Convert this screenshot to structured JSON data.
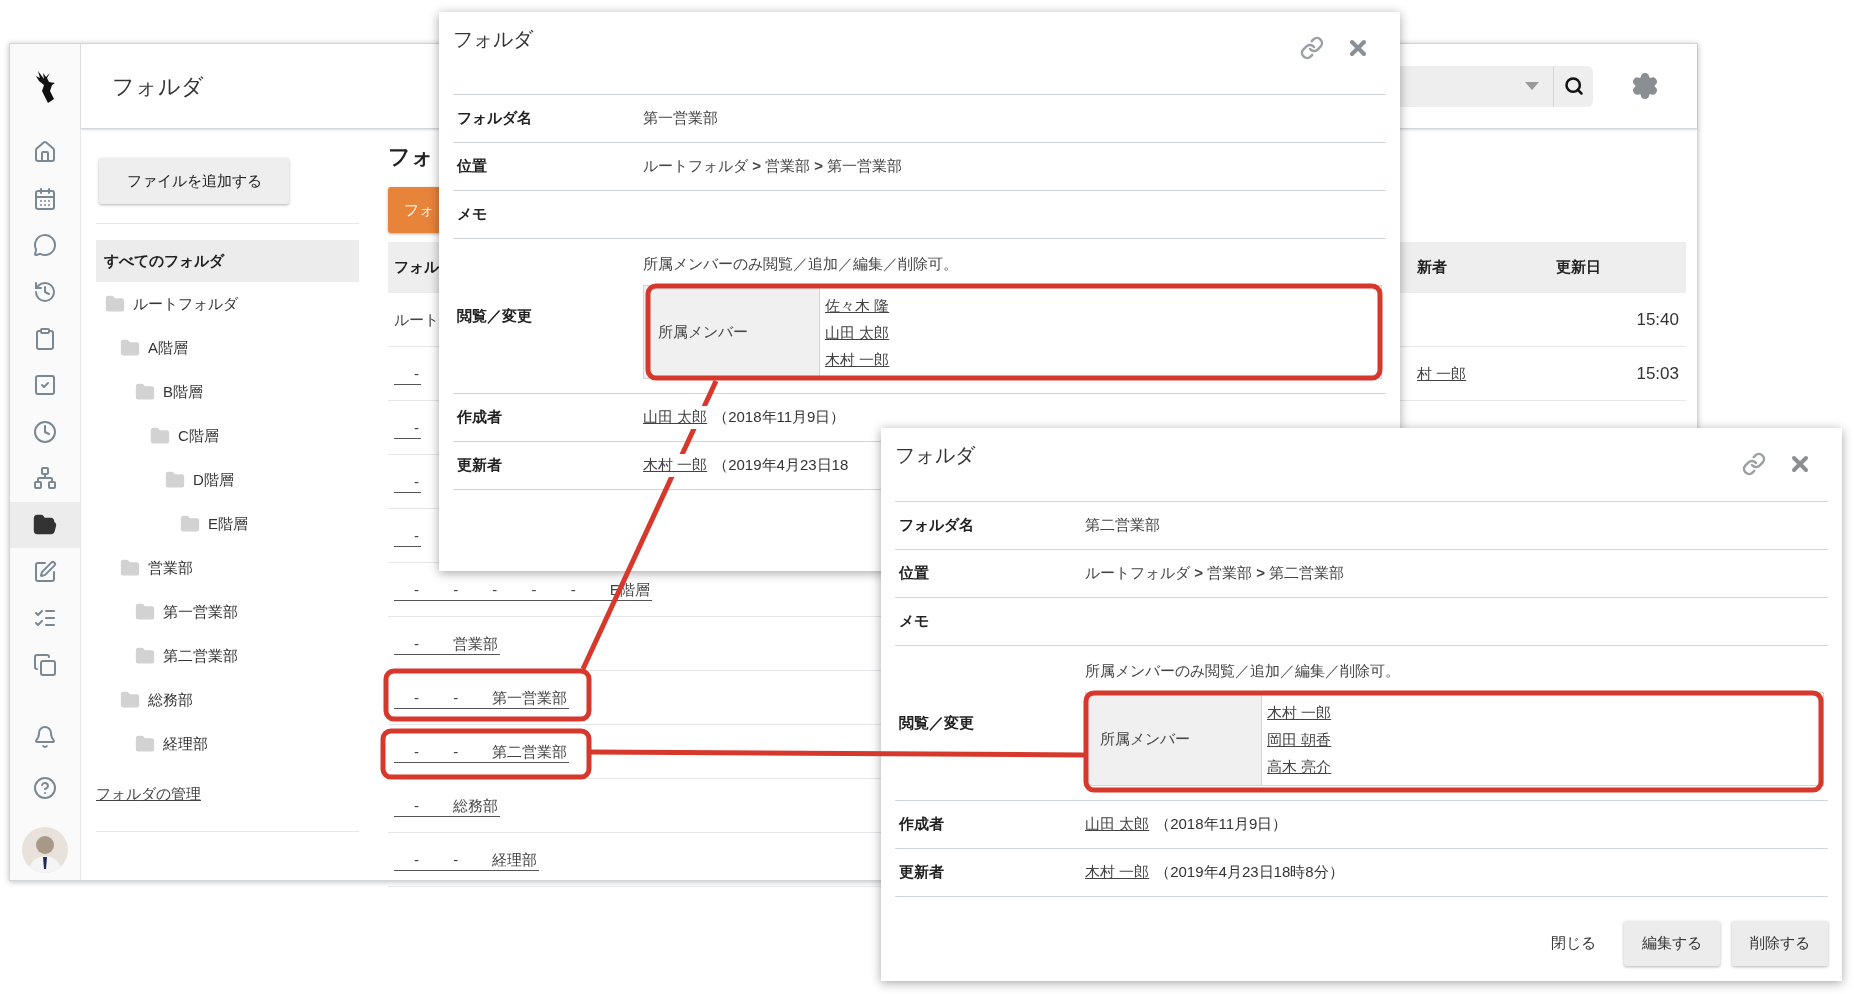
{
  "app": {
    "title": "フォルダ",
    "nav": [
      {
        "selected": false
      },
      {
        "selected": false
      },
      {
        "selected": false
      },
      {
        "selected": false
      },
      {
        "selected": false
      },
      {
        "selected": false
      },
      {
        "selected": false
      },
      {
        "selected": false
      },
      {
        "selected": true
      },
      {
        "selected": false
      },
      {
        "selected": false
      },
      {
        "selected": false
      },
      {
        "selected": false
      },
      {
        "selected": false
      }
    ]
  },
  "folders": {
    "add_button": "ファイルを追加する",
    "all": {
      "label": "すべてのフォルダ",
      "selected": true
    },
    "manage_link": "フォルダの管理",
    "tree": [
      {
        "label": "ルートフォルダ",
        "selected": false,
        "children": [
          {
            "label": "A階層",
            "selected": false,
            "children": [
              {
                "label": "B階層",
                "selected": false,
                "children": [
                  {
                    "label": "C階層",
                    "selected": false,
                    "children": [
                      {
                        "label": "D階層",
                        "selected": false,
                        "children": [
                          {
                            "label": "E階層",
                            "selected": false
                          }
                        ]
                      }
                    ]
                  }
                ]
              }
            ]
          },
          {
            "label": "営業部",
            "selected": false,
            "children": [
              {
                "label": "第一営業部",
                "selected": false
              },
              {
                "label": "第二営業部",
                "selected": false
              }
            ]
          },
          {
            "label": "総務部",
            "selected": false,
            "children": [
              {
                "label": "経理部",
                "selected": false
              }
            ]
          }
        ]
      }
    ]
  },
  "list": {
    "title": "フォ",
    "create_button": "フォ",
    "columns": [
      "フォル",
      "新者",
      "更新日"
    ],
    "rows": [
      {
        "name": "ルート",
        "link": false,
        "time": "15:40"
      },
      {
        "name": "-",
        "link": true,
        "updater": "村 一郎",
        "time": "15:03"
      },
      {
        "name": "-",
        "link": true
      },
      {
        "name": "-",
        "link": true
      },
      {
        "name": "-",
        "link": true
      },
      {
        "name": "- - - - - E階層",
        "link": true
      },
      {
        "name": "- 営業部",
        "link": true
      },
      {
        "name": "- - 第一営業部",
        "link": true
      },
      {
        "name": "- - 第二営業部",
        "link": true
      },
      {
        "name": "- 総務部",
        "link": true
      },
      {
        "name": "- - 経理部",
        "link": true
      }
    ]
  },
  "dialogs": [
    {
      "title": "フォルダ",
      "fields": [
        {
          "kind": "text",
          "label": "フォルダ名",
          "value": "第一営業部"
        },
        {
          "kind": "text",
          "label": "位置",
          "value": "ルートフォルダ **>** 営業部 **>** 第一営業部"
        },
        {
          "kind": "text",
          "label": "メモ"
        },
        {
          "kind": "permissions",
          "label": "閲覧／変更",
          "note": "所属メンバーのみ閲覧／追加／編集／削除可。",
          "group": "所属メンバー",
          "members": [
            "佐々木 隆",
            "山田 太郎",
            "木村 一郎"
          ]
        },
        {
          "kind": "user",
          "label": "作成者",
          "user": "山田 太郎",
          "date": "（2018年11月9日）"
        },
        {
          "kind": "user",
          "label": "更新者",
          "user": "木村 一郎",
          "date": "（2019年4月23日18"
        }
      ]
    },
    {
      "title": "フォルダ",
      "fields": [
        {
          "kind": "text",
          "label": "フォルダ名",
          "value": "第二営業部"
        },
        {
          "kind": "text",
          "label": "位置",
          "value": "ルートフォルダ **>** 営業部 **>** 第二営業部"
        },
        {
          "kind": "text",
          "label": "メモ"
        },
        {
          "kind": "permissions",
          "label": "閲覧／変更",
          "note": "所属メンバーのみ閲覧／追加／編集／削除可。",
          "group": "所属メンバー",
          "members": [
            "木村 一郎",
            "岡田 朝香",
            "高木 亮介"
          ]
        },
        {
          "kind": "user",
          "label": "作成者",
          "user": "山田 太郎",
          "date": "（2018年11月9日）"
        },
        {
          "kind": "user",
          "label": "更新者",
          "user": "木村 一郎",
          "date": "（2019年4月23日18時8分）"
        }
      ],
      "buttons": [
        {
          "label": "閉じる",
          "kind": "flat"
        },
        {
          "label": "編集する",
          "kind": "raised"
        },
        {
          "label": "削除する",
          "kind": "raised"
        }
      ]
    }
  ]
}
